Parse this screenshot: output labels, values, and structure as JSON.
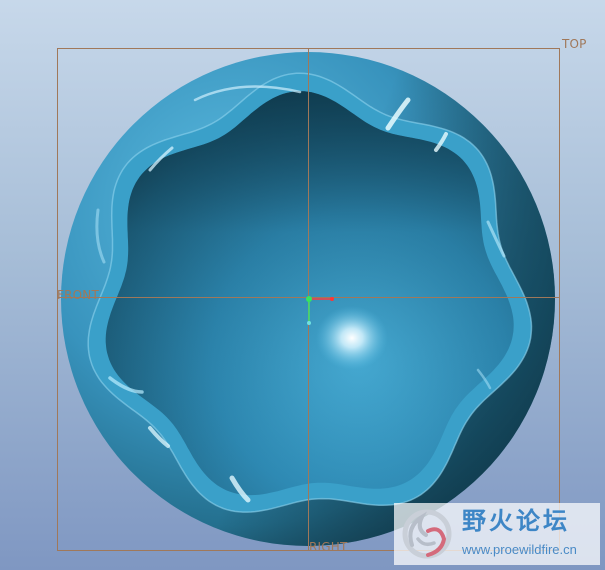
{
  "viewport": {
    "background_top": "#c7d8ea",
    "background_bottom": "#7f97c2",
    "model_color": "#3a9bc4",
    "datum_color": "#a0785a"
  },
  "datum_planes": {
    "top": "TOP",
    "front": "FRONT",
    "right": "RIGHT"
  },
  "watermark": {
    "title": "野火论坛",
    "url": "www.proewildfire.cn",
    "logo_icon": "flame-swirl-logo"
  }
}
